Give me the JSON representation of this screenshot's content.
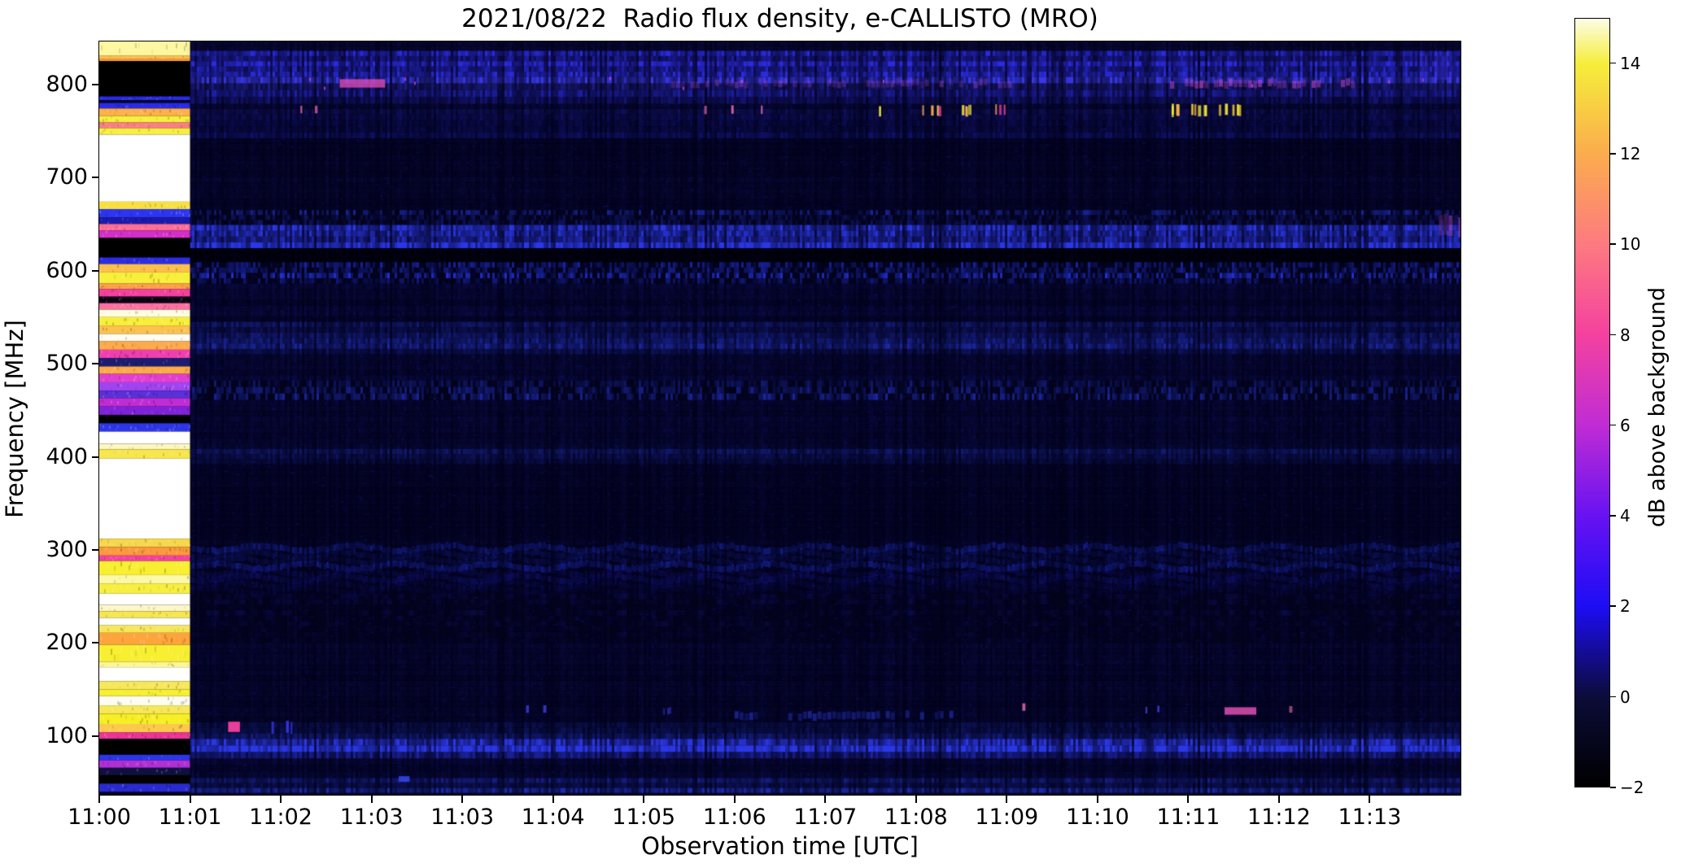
{
  "chart_data": {
    "type": "heatmap",
    "title": "2021/08/22  Radio flux density, e-CALLISTO (MRO)",
    "xlabel": "Observation time [UTC]",
    "ylabel": "Frequency [MHz]",
    "grid": false,
    "time_range_min": [
      0,
      15.0
    ],
    "freq_range_mhz": [
      37,
      846
    ],
    "x_ticks": [
      {
        "t": 0,
        "label": "11:00"
      },
      {
        "t": 1,
        "label": "11:01"
      },
      {
        "t": 2,
        "label": "11:02"
      },
      {
        "t": 3,
        "label": "11:03"
      },
      {
        "t": 4,
        "label": "11:03"
      },
      {
        "t": 5,
        "label": "11:04"
      },
      {
        "t": 6,
        "label": "11:05"
      },
      {
        "t": 7,
        "label": "11:06"
      },
      {
        "t": 8,
        "label": "11:07"
      },
      {
        "t": 9,
        "label": "11:08"
      },
      {
        "t": 10,
        "label": "11:09"
      },
      {
        "t": 11,
        "label": "11:10"
      },
      {
        "t": 12,
        "label": "11:11"
      },
      {
        "t": 13,
        "label": "11:12"
      },
      {
        "t": 14,
        "label": "11:13"
      }
    ],
    "y_ticks": [
      800,
      700,
      600,
      500,
      400,
      300,
      200,
      100
    ],
    "colorbar": {
      "label": "dB above background",
      "range": [
        -2,
        15
      ],
      "ticks": [
        14,
        12,
        10,
        8,
        6,
        4,
        2,
        0,
        -2
      ],
      "colormap_stops": [
        {
          "v": -2,
          "c": "#000000"
        },
        {
          "v": 0,
          "c": "#0c0c3a"
        },
        {
          "v": 2,
          "c": "#1d0df5"
        },
        {
          "v": 4,
          "c": "#6812f2"
        },
        {
          "v": 6,
          "c": "#c02cd4"
        },
        {
          "v": 8,
          "c": "#f4419f"
        },
        {
          "v": 10,
          "c": "#fd7a80"
        },
        {
          "v": 12,
          "c": "#fbac4d"
        },
        {
          "v": 14,
          "c": "#f5ee3a"
        },
        {
          "v": 15,
          "c": "#fcfce6"
        }
      ]
    },
    "background": "#020216",
    "calibration_segment": {
      "t_start_min": 0.0,
      "t_end_min": 1.0,
      "bands": [
        {
          "f_hi": 846,
          "f_lo": 831,
          "color": "#fdf7a0"
        },
        {
          "f_hi": 831,
          "f_lo": 827,
          "color": "#ffc04d"
        },
        {
          "f_hi": 827,
          "f_lo": 825,
          "color": "#ff9a3c"
        },
        {
          "f_hi": 825,
          "f_lo": 787,
          "color": "#000000"
        },
        {
          "f_hi": 787,
          "f_lo": 783,
          "color": "#2a2ae8"
        },
        {
          "f_hi": 783,
          "f_lo": 780,
          "color": "#05051f"
        },
        {
          "f_hi": 780,
          "f_lo": 774,
          "color": "#2a2ae8"
        },
        {
          "f_hi": 774,
          "f_lo": 766,
          "color": "#ffb04a"
        },
        {
          "f_hi": 766,
          "f_lo": 759,
          "color": "#f7ef3f"
        },
        {
          "f_hi": 759,
          "f_lo": 753,
          "color": "#fd7d85"
        },
        {
          "f_hi": 753,
          "f_lo": 746,
          "color": "#f7ef3f"
        },
        {
          "f_hi": 746,
          "f_lo": 674,
          "color": "#ffffff"
        },
        {
          "f_hi": 674,
          "f_lo": 666,
          "color": "#f7e03f"
        },
        {
          "f_hi": 666,
          "f_lo": 657,
          "color": "#2d35f0"
        },
        {
          "f_hi": 657,
          "f_lo": 650,
          "color": "#1a1ab0"
        },
        {
          "f_hi": 650,
          "f_lo": 643,
          "color": "#fd6f95"
        },
        {
          "f_hi": 643,
          "f_lo": 635,
          "color": "#d42fc8"
        },
        {
          "f_hi": 635,
          "f_lo": 614,
          "color": "#000000"
        },
        {
          "f_hi": 614,
          "f_lo": 607,
          "color": "#2d2de8"
        },
        {
          "f_hi": 607,
          "f_lo": 598,
          "color": "#fdc04a"
        },
        {
          "f_hi": 598,
          "f_lo": 586,
          "color": "#f7ef3a"
        },
        {
          "f_hi": 586,
          "f_lo": 580,
          "color": "#fda04a"
        },
        {
          "f_hi": 580,
          "f_lo": 572,
          "color": "#f4419f"
        },
        {
          "f_hi": 572,
          "f_lo": 565,
          "color": "#0a0112"
        },
        {
          "f_hi": 565,
          "f_lo": 558,
          "color": "#fd6f9f"
        },
        {
          "f_hi": 558,
          "f_lo": 550,
          "color": "#fffde0"
        },
        {
          "f_hi": 550,
          "f_lo": 541,
          "color": "#f7ef3a"
        },
        {
          "f_hi": 541,
          "f_lo": 532,
          "color": "#fdc24d"
        },
        {
          "f_hi": 532,
          "f_lo": 524,
          "color": "#fffcf0"
        },
        {
          "f_hi": 524,
          "f_lo": 515,
          "color": "#fdaa4a"
        },
        {
          "f_hi": 515,
          "f_lo": 506,
          "color": "#ef3fae"
        },
        {
          "f_hi": 506,
          "f_lo": 497,
          "color": "#1c1c70"
        },
        {
          "f_hi": 497,
          "f_lo": 489,
          "color": "#fdaa4a"
        },
        {
          "f_hi": 489,
          "f_lo": 480,
          "color": "#e23fd0"
        },
        {
          "f_hi": 480,
          "f_lo": 471,
          "color": "#a044f0"
        },
        {
          "f_hi": 471,
          "f_lo": 463,
          "color": "#5a30d8"
        },
        {
          "f_hi": 463,
          "f_lo": 454,
          "color": "#c02cd4"
        },
        {
          "f_hi": 454,
          "f_lo": 445,
          "color": "#8022d8"
        },
        {
          "f_hi": 445,
          "f_lo": 436,
          "color": "#000000"
        },
        {
          "f_hi": 436,
          "f_lo": 427,
          "color": "#2d35e8"
        },
        {
          "f_hi": 427,
          "f_lo": 414,
          "color": "#ffffff"
        },
        {
          "f_hi": 414,
          "f_lo": 408,
          "color": "#fdf7c0"
        },
        {
          "f_hi": 408,
          "f_lo": 398,
          "color": "#f7e74d"
        },
        {
          "f_hi": 398,
          "f_lo": 312,
          "color": "#ffffff"
        },
        {
          "f_hi": 312,
          "f_lo": 303,
          "color": "#f7d84d"
        },
        {
          "f_hi": 303,
          "f_lo": 294,
          "color": "#fd9a3c"
        },
        {
          "f_hi": 294,
          "f_lo": 288,
          "color": "#f4419f"
        },
        {
          "f_hi": 288,
          "f_lo": 273,
          "color": "#f7ef2f"
        },
        {
          "f_hi": 273,
          "f_lo": 264,
          "color": "#fdf7a8"
        },
        {
          "f_hi": 264,
          "f_lo": 253,
          "color": "#f7ef3f"
        },
        {
          "f_hi": 253,
          "f_lo": 241,
          "color": "#ffffff"
        },
        {
          "f_hi": 241,
          "f_lo": 234,
          "color": "#fdf7c8"
        },
        {
          "f_hi": 234,
          "f_lo": 227,
          "color": "#f7e74d"
        },
        {
          "f_hi": 227,
          "f_lo": 219,
          "color": "#ffffff"
        },
        {
          "f_hi": 219,
          "f_lo": 211,
          "color": "#f7e75a"
        },
        {
          "f_hi": 211,
          "f_lo": 198,
          "color": "#fda43c"
        },
        {
          "f_hi": 198,
          "f_lo": 180,
          "color": "#f7ef2f"
        },
        {
          "f_hi": 180,
          "f_lo": 174,
          "color": "#fdf790"
        },
        {
          "f_hi": 174,
          "f_lo": 159,
          "color": "#ffffff"
        },
        {
          "f_hi": 159,
          "f_lo": 150,
          "color": "#f7e75a"
        },
        {
          "f_hi": 150,
          "f_lo": 143,
          "color": "#f7ef2f"
        },
        {
          "f_hi": 143,
          "f_lo": 133,
          "color": "#fffdf0"
        },
        {
          "f_hi": 133,
          "f_lo": 124,
          "color": "#f7e75a"
        },
        {
          "f_hi": 124,
          "f_lo": 113,
          "color": "#f7ef25"
        },
        {
          "f_hi": 113,
          "f_lo": 104,
          "color": "#fdc84d"
        },
        {
          "f_hi": 104,
          "f_lo": 97,
          "color": "#ee3399"
        },
        {
          "f_hi": 97,
          "f_lo": 80,
          "color": "#000000"
        },
        {
          "f_hi": 80,
          "f_lo": 74,
          "color": "#2d35e8"
        },
        {
          "f_hi": 74,
          "f_lo": 66,
          "color": "#b030d8"
        },
        {
          "f_hi": 66,
          "f_lo": 58,
          "color": "#10103f"
        },
        {
          "f_hi": 58,
          "f_lo": 49,
          "color": "#000000"
        },
        {
          "f_hi": 49,
          "f_lo": 40,
          "color": "#2a2ad0"
        },
        {
          "f_hi": 40,
          "f_lo": 37,
          "color": "#05051f"
        }
      ]
    },
    "bands": [
      {
        "f": [
          846,
          836
        ],
        "color": "#141466",
        "a": 0.2,
        "style": "noise"
      },
      {
        "f": [
          836,
          808
        ],
        "color": "#2d2de8",
        "a": 0.7,
        "style": "noise"
      },
      {
        "f": [
          808,
          794
        ],
        "color": "#3a3aee",
        "a": 0.55,
        "style": "noise",
        "speckle": "#cc44cc"
      },
      {
        "f": [
          794,
          779
        ],
        "color": "#2a2add",
        "a": 0.45,
        "style": "noise"
      },
      {
        "f": [
          779,
          768
        ],
        "color": "#1c1c90",
        "a": 0.3,
        "style": "noise"
      },
      {
        "f": [
          768,
          742
        ],
        "color": "#1c1ca8",
        "a": 0.3,
        "style": "noise"
      },
      {
        "f": [
          742,
          665
        ],
        "color": "#141470",
        "a": 0.15,
        "style": "noise"
      },
      {
        "f": [
          665,
          649
        ],
        "color": "#2433cc",
        "a": 0.4,
        "style": "dashes"
      },
      {
        "f": [
          649,
          624
        ],
        "color": "#2d3af0",
        "a": 0.8,
        "style": "noise"
      },
      {
        "f": [
          624,
          609
        ],
        "color": "#000000",
        "a": 0.55,
        "style": "solid"
      },
      {
        "f": [
          609,
          586
        ],
        "color": "#2433dd",
        "a": 0.5,
        "style": "dashes"
      },
      {
        "f": [
          586,
          545
        ],
        "color": "#141478",
        "a": 0.2,
        "style": "noise"
      },
      {
        "f": [
          545,
          510
        ],
        "color": "#2433cc",
        "a": 0.4,
        "style": "noise"
      },
      {
        "f": [
          510,
          482
        ],
        "color": "#141478",
        "a": 0.25,
        "style": "noise"
      },
      {
        "f": [
          482,
          461
        ],
        "color": "#2433cc",
        "a": 0.45,
        "style": "dashes"
      },
      {
        "f": [
          461,
          414
        ],
        "color": "#121270",
        "a": 0.18,
        "style": "noise"
      },
      {
        "f": [
          414,
          392
        ],
        "color": "#1c2aaa",
        "a": 0.3,
        "style": "noise"
      },
      {
        "f": [
          392,
          305
        ],
        "color": "#0f0f5e",
        "a": 0.13,
        "style": "noise"
      },
      {
        "f": [
          305,
          279
        ],
        "color": "#1c2abb",
        "a": 0.4,
        "style": "wavy"
      },
      {
        "f": [
          279,
          253
        ],
        "color": "#161690",
        "a": 0.25,
        "style": "wavy"
      },
      {
        "f": [
          253,
          200
        ],
        "color": "#121268",
        "a": 0.22,
        "style": "bars"
      },
      {
        "f": [
          200,
          165
        ],
        "color": "#101060",
        "a": 0.2,
        "style": "noise"
      },
      {
        "f": [
          165,
          137
        ],
        "color": "#101060",
        "a": 0.18,
        "style": "noise"
      },
      {
        "f": [
          137,
          115
        ],
        "color": "#121268",
        "a": 0.2,
        "style": "noise"
      },
      {
        "f": [
          115,
          97
        ],
        "color": "#1c2aaa",
        "a": 0.35,
        "style": "noise"
      },
      {
        "f": [
          97,
          76
        ],
        "color": "#2d3af0",
        "a": 0.8,
        "style": "noise"
      },
      {
        "f": [
          76,
          55
        ],
        "color": "#161685",
        "a": 0.25,
        "style": "noise"
      },
      {
        "f": [
          55,
          39
        ],
        "color": "#2433cc",
        "a": 0.5,
        "style": "noise"
      },
      {
        "f": [
          39,
          37
        ],
        "color": "#0a0a30",
        "a": 0.4,
        "style": "solid"
      }
    ],
    "events": [
      {
        "type": "blob",
        "t0": 2.65,
        "t1": 3.15,
        "f": 801,
        "df": 9,
        "color": "#e84fc0",
        "a": 0.75
      },
      {
        "type": "patch",
        "t0": 11.8,
        "t1": 13.8,
        "f": 801,
        "df": 8,
        "color": "#d84fd0",
        "a": 0.55
      },
      {
        "type": "patch",
        "t0": 6.3,
        "t1": 10.1,
        "f": 801,
        "df": 7,
        "color": "#c04fd8",
        "a": 0.35
      },
      {
        "type": "ticks",
        "t0": 8.3,
        "t1": 10.0,
        "f": 772,
        "df": 11,
        "colors": [
          "#f7ef3a",
          "#fdaa4a",
          "#f4419f"
        ],
        "count": 12,
        "a": 0.95
      },
      {
        "type": "ticks",
        "t0": 11.75,
        "t1": 12.6,
        "f": 772,
        "df": 12,
        "colors": [
          "#f7ef3a",
          "#f7d82f",
          "#fdaa4a"
        ],
        "count": 14,
        "a": 0.95
      },
      {
        "type": "ticks",
        "t0": 6.6,
        "t1": 7.3,
        "f": 772,
        "df": 9,
        "colors": [
          "#f46fae"
        ],
        "count": 3,
        "a": 0.9
      },
      {
        "type": "ticks",
        "t0": 2.2,
        "t1": 2.5,
        "f": 772,
        "df": 8,
        "colors": [
          "#f46fae",
          "#fdaa4a"
        ],
        "count": 2,
        "a": 0.9
      },
      {
        "type": "blob",
        "t0": 1.42,
        "t1": 1.55,
        "f": 110,
        "df": 11,
        "color": "#f4419f",
        "a": 0.95
      },
      {
        "type": "ticks",
        "t0": 1.7,
        "t1": 2.15,
        "f": 110,
        "df": 13,
        "colors": [
          "#3a3af5"
        ],
        "count": 3,
        "a": 0.9
      },
      {
        "type": "blob",
        "t0": 3.3,
        "t1": 3.42,
        "f": 54,
        "df": 6,
        "color": "#3a4af5",
        "a": 0.8
      },
      {
        "type": "ticks",
        "t0": 4.7,
        "t1": 5.0,
        "f": 130,
        "df": 8,
        "colors": [
          "#f46fae",
          "#4a4af5"
        ],
        "count": 2,
        "a": 0.9
      },
      {
        "type": "ticks",
        "t0": 5.2,
        "t1": 6.3,
        "f": 127,
        "df": 7,
        "colors": [
          "#3a3ae0"
        ],
        "count": 3,
        "a": 0.7
      },
      {
        "type": "patch",
        "t0": 7.0,
        "t1": 9.4,
        "f": 122,
        "df": 8,
        "color": "#2a35c8",
        "a": 0.6
      },
      {
        "type": "ticks",
        "t0": 10.1,
        "t1": 10.25,
        "f": 131,
        "df": 8,
        "colors": [
          "#f46fae"
        ],
        "count": 1,
        "a": 0.9
      },
      {
        "type": "blob",
        "t0": 12.4,
        "t1": 12.75,
        "f": 127,
        "df": 8,
        "color": "#e04fb0",
        "a": 0.85
      },
      {
        "type": "ticks",
        "t0": 11.45,
        "t1": 11.7,
        "f": 128,
        "df": 7,
        "colors": [
          "#4a4af5"
        ],
        "count": 2,
        "a": 0.8
      },
      {
        "type": "ticks",
        "t0": 13.1,
        "t1": 13.2,
        "f": 130,
        "df": 7,
        "colors": [
          "#f46fae"
        ],
        "count": 1,
        "a": 0.8
      },
      {
        "type": "patch",
        "t0": 14.6,
        "t1": 15.0,
        "f": 648,
        "df": 22,
        "color": "#d04fc0",
        "a": 0.5
      },
      {
        "type": "patch",
        "t0": 14.55,
        "t1": 15.0,
        "f": 820,
        "df": 30,
        "color": "#4a3af8",
        "a": 0.5
      }
    ]
  }
}
